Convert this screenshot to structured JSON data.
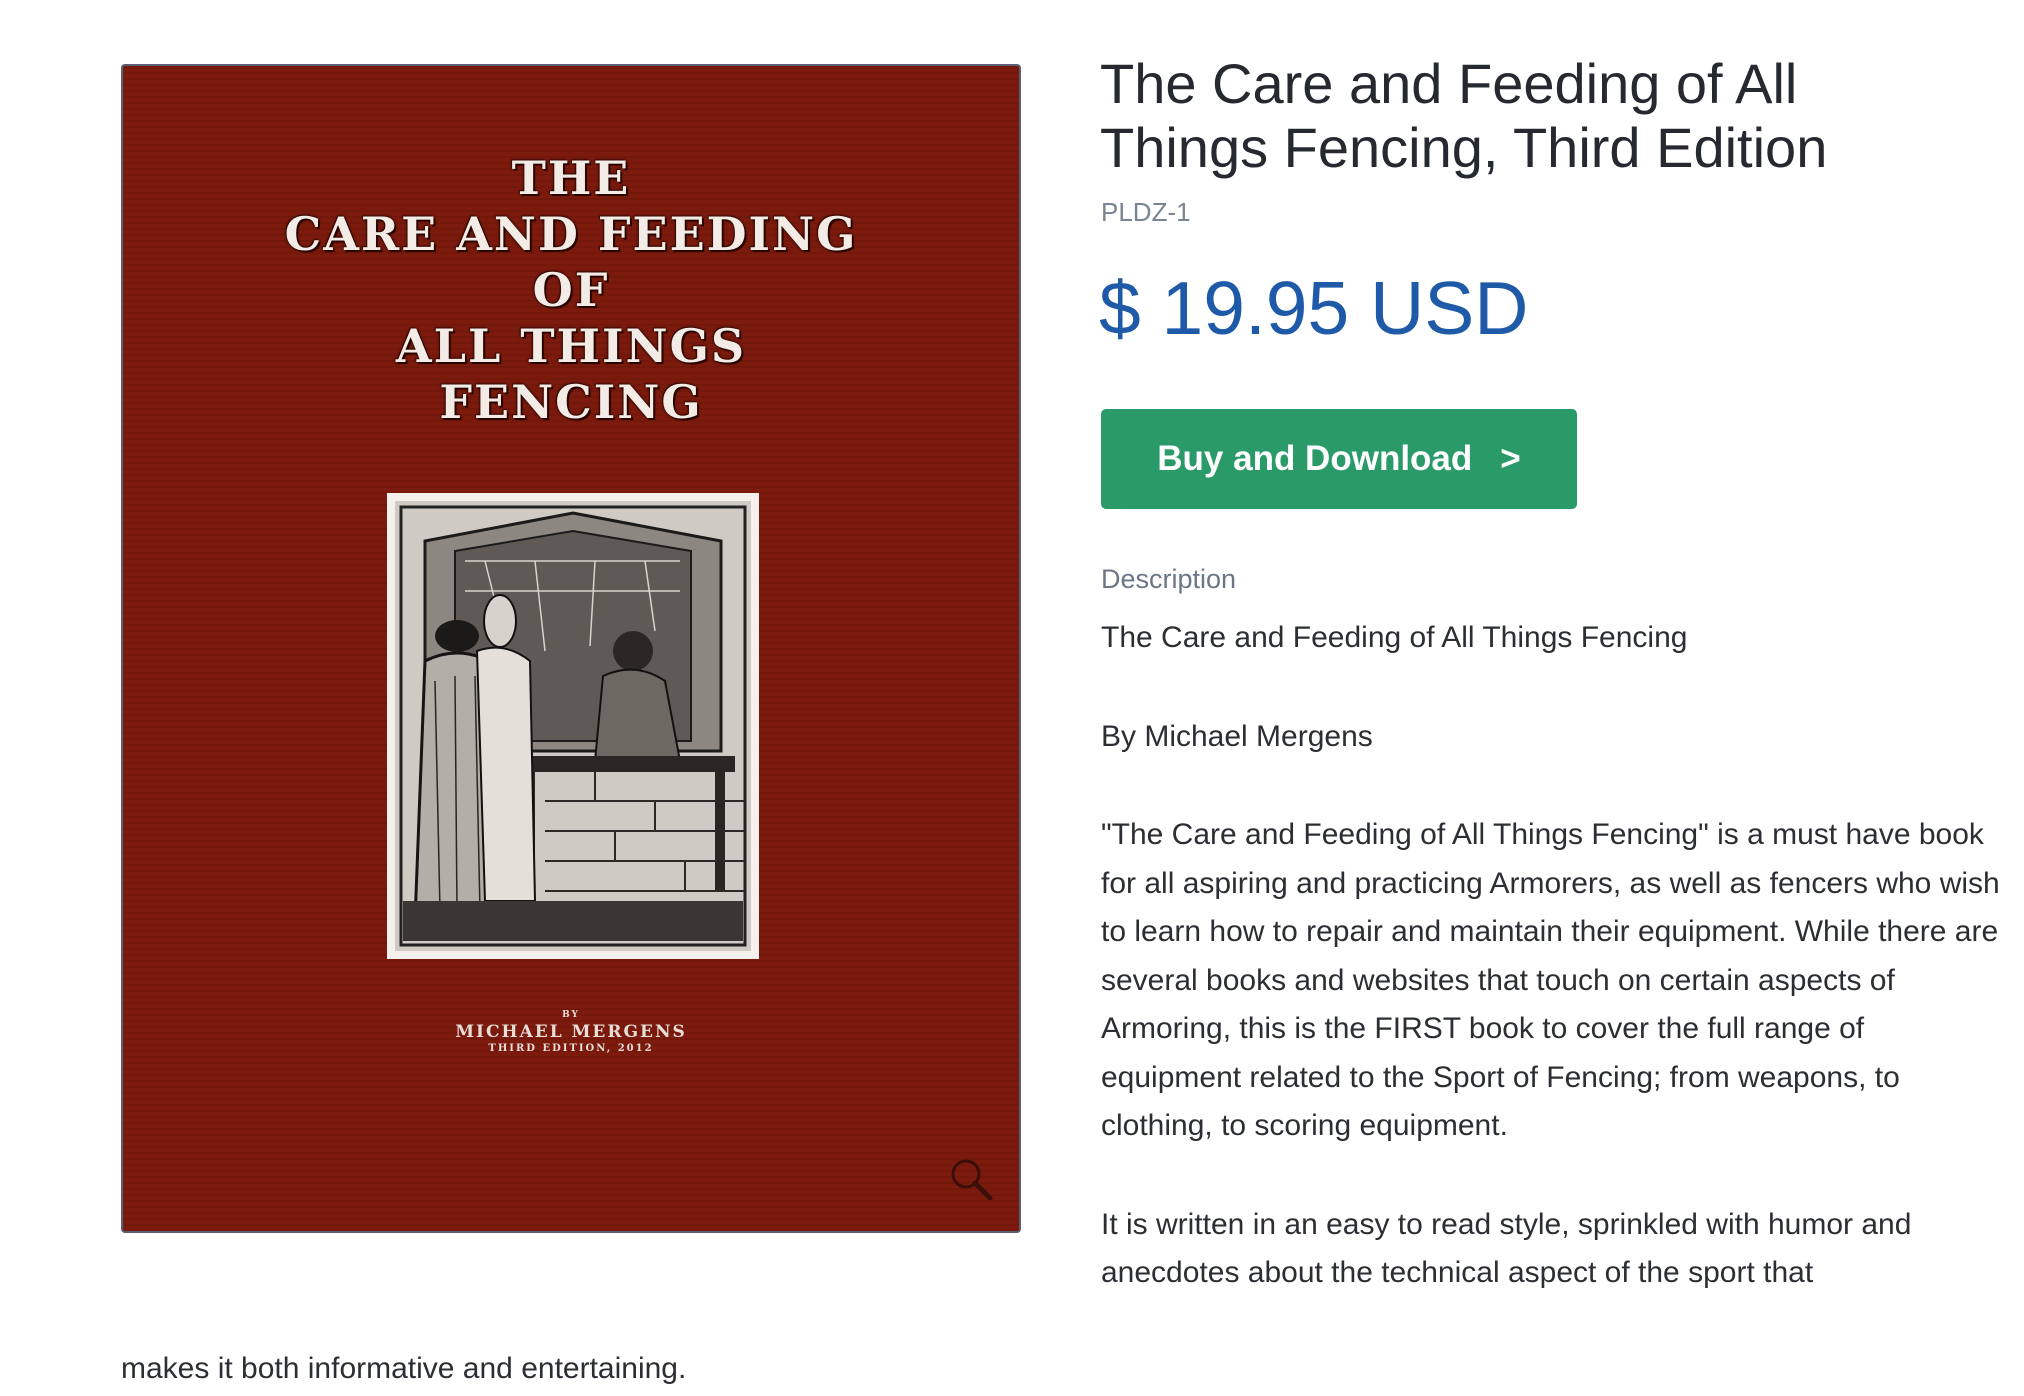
{
  "cover": {
    "title_lines": [
      "THE",
      "CARE AND FEEDING",
      "OF",
      "ALL THINGS",
      "FENCING"
    ],
    "by": "BY",
    "author": "MICHAEL MERGENS",
    "edition": "THIRD EDITION, 2012",
    "background_color": "#7c1a0d",
    "zoom_icon": "magnifier-icon"
  },
  "product": {
    "title": "The Care and Feeding of All Things Fencing, Third Edition",
    "sku": "PLDZ-1",
    "price": "$ 19.95 USD",
    "price_color": "#1f5aa8"
  },
  "buy_button": {
    "label": "Buy and Download",
    "arrow": ">",
    "color": "#2a9b68"
  },
  "description": {
    "heading": "Description",
    "paragraphs": [
      "The Care and Feeding of All Things Fencing",
      "By Michael Mergens",
      "\"The Care and Feeding of All Things Fencing\" is a must have book for all aspiring and practicing Armorers, as well as fencers who wish to learn how to repair and maintain their equipment. While there are several books and websites that touch on certain aspects of Armoring, this is the FIRST book to cover the full range of equipment related to the Sport of Fencing; from weapons, to clothing, to scoring equipment.",
      "It is written in an easy to read style, sprinkled with humor and anecdotes about the technical aspect of the sport that"
    ],
    "tail": "makes it both informative and entertaining."
  }
}
